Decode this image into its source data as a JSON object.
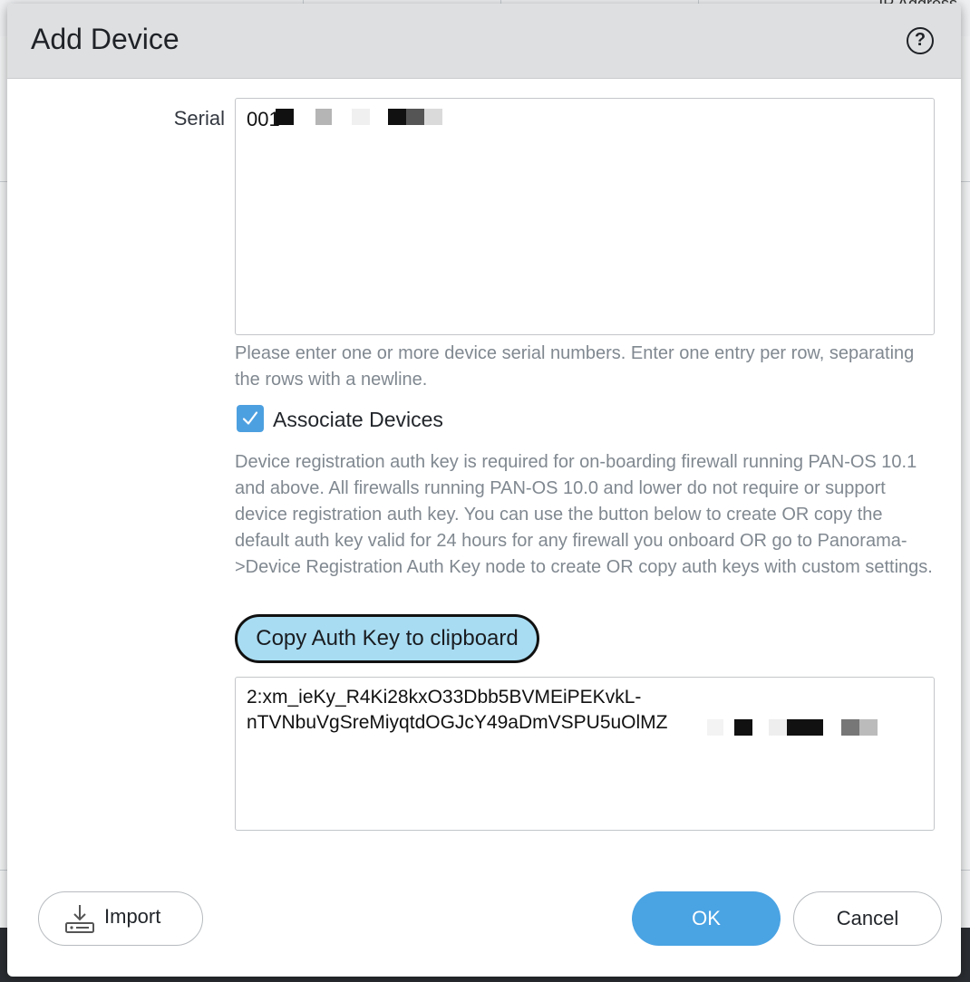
{
  "background": {
    "header_label": "IP Address"
  },
  "dialog": {
    "title": "Add Device",
    "help_glyph": "?",
    "serial_label": "Serial",
    "serial_value": "001",
    "serial_hint": "Please enter one or more device serial numbers. Enter one entry per row, separating the rows with a newline.",
    "associate_label": "Associate Devices",
    "associate_checked": true,
    "auth_description": "Device registration auth key is required for on-boarding firewall running PAN-OS 10.1 and above. All firewalls running PAN-OS 10.0 and lower do not require or support device registration auth key. You can use the button below to create OR copy the default auth key valid for 24 hours for any firewall you onboard OR go to Panorama->Device Registration Auth Key node to create OR copy auth keys with custom settings.",
    "copy_button_label": "Copy Auth Key to clipboard",
    "auth_key_line1": "2:xm_ieKy_R4Ki28kxO33Dbb5BVMEiPEKvkL-",
    "auth_key_line2": "nTVNbuVgSreMiyqtdOGJcY49aDmVSPU5uOlMZ",
    "import_label": "Import",
    "ok_label": "OK",
    "cancel_label": "Cancel"
  },
  "colors": {
    "accent": "#4aa3e3",
    "copy_button_bg": "#a8dcf2",
    "hint_text": "#808890"
  },
  "icons": {
    "help": "help-icon",
    "checkbox": "checkmark-icon",
    "import": "import-icon"
  }
}
